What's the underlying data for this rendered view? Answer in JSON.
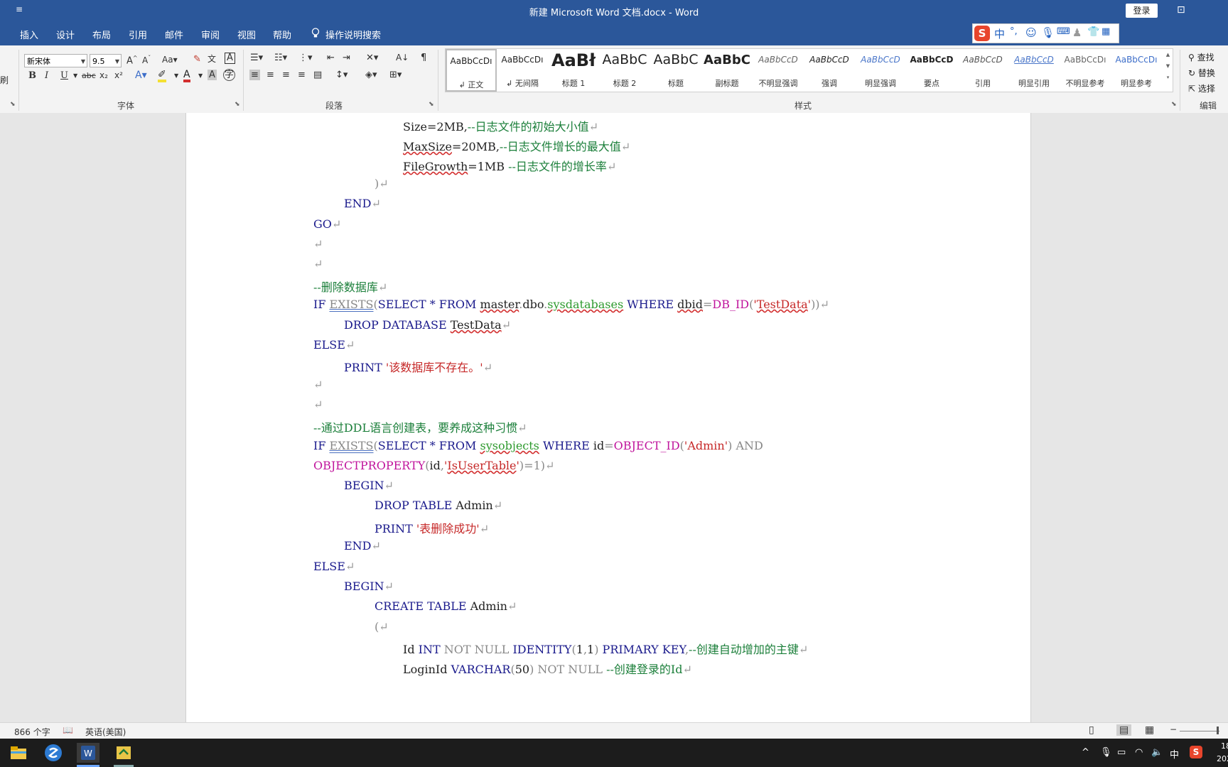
{
  "window": {
    "title": "新建 Microsoft Word 文档.docx  -  Word",
    "quick_access": "≡",
    "login": "登录",
    "ribbon_options": "⊡"
  },
  "tabs": [
    "插入",
    "设计",
    "布局",
    "引用",
    "邮件",
    "审阅",
    "视图",
    "帮助"
  ],
  "tell_me": "操作说明搜索",
  "ime": {
    "logo": "S",
    "mode": "中",
    "punct": "°,"
  },
  "font": {
    "name": "新宋体",
    "size": "9.5",
    "group_label": "字体"
  },
  "paragraph": {
    "group_label": "段落"
  },
  "styles": {
    "group_label": "样式",
    "items": [
      {
        "preview": "AaBbCcDı",
        "name": "↲ 正文"
      },
      {
        "preview": "AaBbCcDı",
        "name": "↲ 无间隔"
      },
      {
        "preview": "AaBł",
        "name": "标题 1"
      },
      {
        "preview": "AaBbC",
        "name": "标题 2"
      },
      {
        "preview": "AaBbC",
        "name": "标题"
      },
      {
        "preview": "AaBbC",
        "name": "副标题"
      },
      {
        "preview": "AaBbCcD",
        "name": "不明显强调"
      },
      {
        "preview": "AaBbCcD",
        "name": "强调"
      },
      {
        "preview": "AaBbCcD",
        "name": "明显强调"
      },
      {
        "preview": "AaBbCcD",
        "name": "要点"
      },
      {
        "preview": "AaBbCcD",
        "name": "引用"
      },
      {
        "preview": "AaBbCcD",
        "name": "明显引用"
      },
      {
        "preview": "AaBbCcDı",
        "name": "不明显参考"
      },
      {
        "preview": "AaBbCcDı",
        "name": "明显参考"
      }
    ]
  },
  "editing": {
    "find": "查找",
    "replace": "替换",
    "select": "选择",
    "group_label": "编辑"
  },
  "left_clip": {
    "brush": "刷"
  },
  "code_lines": [
    [
      {
        "t": "Size",
        "c": "tx"
      },
      {
        "t": "=2MB,",
        "c": "tx"
      },
      {
        "t": "--日志文件的初始大小值",
        "c": "cm"
      },
      {
        "t": "↵",
        "c": "mark"
      }
    ],
    [
      {
        "t": "MaxSize",
        "c": "tx sq"
      },
      {
        "t": "=20MB,",
        "c": "tx"
      },
      {
        "t": "--日志文件增长的最大值",
        "c": "cm"
      },
      {
        "t": "↵",
        "c": "mark"
      }
    ],
    [
      {
        "t": "FileGrowth",
        "c": "tx sq"
      },
      {
        "t": "=1MB ",
        "c": "tx"
      },
      {
        "t": "--日志文件的增长率",
        "c": "cm"
      },
      {
        "t": "↵",
        "c": "mark"
      }
    ],
    [
      {
        "t": ")",
        "c": "gr"
      },
      {
        "t": "↵",
        "c": "mark"
      }
    ],
    [
      {
        "t": "END",
        "c": "kw"
      },
      {
        "t": "↵",
        "c": "mark"
      }
    ],
    [
      {
        "t": "GO",
        "c": "kw"
      },
      {
        "t": "↵",
        "c": "mark"
      }
    ],
    [
      {
        "t": "↵",
        "c": "mark"
      }
    ],
    [
      {
        "t": "↵",
        "c": "mark"
      }
    ],
    [
      {
        "t": "--删除数据库",
        "c": "cm"
      },
      {
        "t": "↵",
        "c": "mark"
      }
    ],
    [
      {
        "t": "IF ",
        "c": "kw"
      },
      {
        "t": "EXISTS",
        "c": "gr dq"
      },
      {
        "t": "(",
        "c": "gr"
      },
      {
        "t": "SELECT * FROM ",
        "c": "kw"
      },
      {
        "t": "master",
        "c": "tx sq"
      },
      {
        "t": ".",
        "c": "gr"
      },
      {
        "t": "dbo",
        "c": "tx"
      },
      {
        "t": ".",
        "c": "gr"
      },
      {
        "t": "sysdatabases",
        "c": "sys sq"
      },
      {
        "t": " WHERE ",
        "c": "kw"
      },
      {
        "t": "dbid",
        "c": "tx sq"
      },
      {
        "t": "=",
        "c": "gr"
      },
      {
        "t": "DB_ID",
        "c": "fn"
      },
      {
        "t": "(",
        "c": "gr"
      },
      {
        "t": "'",
        "c": "str"
      },
      {
        "t": "TestData",
        "c": "str sq"
      },
      {
        "t": "'",
        "c": "str"
      },
      {
        "t": "))",
        "c": "gr"
      },
      {
        "t": "↵",
        "c": "mark"
      }
    ],
    [
      {
        "t": "DROP DATABASE ",
        "c": "kw"
      },
      {
        "t": "TestData",
        "c": "tx sq"
      },
      {
        "t": "↵",
        "c": "mark"
      }
    ],
    [
      {
        "t": "ELSE",
        "c": "kw"
      },
      {
        "t": "↵",
        "c": "mark"
      }
    ],
    [
      {
        "t": "PRINT ",
        "c": "kw"
      },
      {
        "t": "'该数据库不存在。'",
        "c": "str"
      },
      {
        "t": "↵",
        "c": "mark"
      }
    ],
    [
      {
        "t": "↵",
        "c": "mark"
      }
    ],
    [
      {
        "t": "↵",
        "c": "mark"
      }
    ],
    [
      {
        "t": "--通过DDL语言创建表，要养成这种习惯",
        "c": "cm"
      },
      {
        "t": "↵",
        "c": "mark"
      }
    ],
    [
      {
        "t": "IF ",
        "c": "kw"
      },
      {
        "t": "EXISTS",
        "c": "gr dq"
      },
      {
        "t": "(",
        "c": "gr"
      },
      {
        "t": "SELECT * FROM ",
        "c": "kw"
      },
      {
        "t": "sysobjects",
        "c": "sys sq"
      },
      {
        "t": " WHERE ",
        "c": "kw"
      },
      {
        "t": "id",
        "c": "tx"
      },
      {
        "t": "=",
        "c": "gr"
      },
      {
        "t": "OBJECT_ID",
        "c": "fn"
      },
      {
        "t": "(",
        "c": "gr"
      },
      {
        "t": "'Admin'",
        "c": "str"
      },
      {
        "t": ") AND",
        "c": "gr"
      }
    ],
    [
      {
        "t": "OBJECTPROPERTY",
        "c": "fn"
      },
      {
        "t": "(",
        "c": "gr"
      },
      {
        "t": "id",
        "c": "tx"
      },
      {
        "t": ",",
        "c": "gr"
      },
      {
        "t": "'",
        "c": "str"
      },
      {
        "t": "IsUserTable",
        "c": "str sq"
      },
      {
        "t": "'",
        "c": "str"
      },
      {
        "t": ")=1)",
        "c": "gr"
      },
      {
        "t": "↵",
        "c": "mark"
      }
    ],
    [
      {
        "t": "BEGIN",
        "c": "kw"
      },
      {
        "t": "↵",
        "c": "mark"
      }
    ],
    [
      {
        "t": "DROP TABLE ",
        "c": "kw"
      },
      {
        "t": "Admin",
        "c": "tx"
      },
      {
        "t": "↵",
        "c": "mark"
      }
    ],
    [
      {
        "t": "PRINT ",
        "c": "kw"
      },
      {
        "t": "'表删除成功'",
        "c": "str"
      },
      {
        "t": "↵",
        "c": "mark"
      }
    ],
    [
      {
        "t": "END",
        "c": "kw"
      },
      {
        "t": "↵",
        "c": "mark"
      }
    ],
    [
      {
        "t": "ELSE",
        "c": "kw"
      },
      {
        "t": "↵",
        "c": "mark"
      }
    ],
    [
      {
        "t": "BEGIN",
        "c": "kw"
      },
      {
        "t": "↵",
        "c": "mark"
      }
    ],
    [
      {
        "t": "CREATE TABLE ",
        "c": "kw"
      },
      {
        "t": "Admin",
        "c": "tx"
      },
      {
        "t": "↵",
        "c": "mark"
      }
    ],
    [
      {
        "t": "(",
        "c": "gr"
      },
      {
        "t": "↵",
        "c": "mark"
      }
    ],
    [
      {
        "t": "Id ",
        "c": "tx"
      },
      {
        "t": "INT ",
        "c": "kw"
      },
      {
        "t": "NOT NULL ",
        "c": "gr"
      },
      {
        "t": "IDENTITY",
        "c": "kw"
      },
      {
        "t": "(",
        "c": "gr"
      },
      {
        "t": "1",
        "c": "tx"
      },
      {
        "t": ",",
        "c": "gr"
      },
      {
        "t": "1",
        "c": "tx"
      },
      {
        "t": ") ",
        "c": "gr"
      },
      {
        "t": "PRIMARY KEY",
        "c": "kw"
      },
      {
        "t": ",",
        "c": "gr"
      },
      {
        "t": "--创建自动增加的主键",
        "c": "cm"
      },
      {
        "t": "↵",
        "c": "mark"
      }
    ],
    [
      {
        "t": "LoginId ",
        "c": "tx"
      },
      {
        "t": "VARCHAR",
        "c": "kw"
      },
      {
        "t": "(",
        "c": "gr"
      },
      {
        "t": "50",
        "c": "tx"
      },
      {
        "t": ") ",
        "c": "gr"
      },
      {
        "t": "NOT NULL ",
        "c": "gr"
      },
      {
        "t": "--创建登录的Id",
        "c": "cm"
      },
      {
        "t": "↵",
        "c": "mark"
      }
    ]
  ],
  "status": {
    "word_count": "866 个字",
    "language": "英语(美国)",
    "zoom_minus": "−",
    "zoom_plus": "+"
  },
  "tray": {
    "ime": "中",
    "clock": "18",
    "date": "202"
  }
}
